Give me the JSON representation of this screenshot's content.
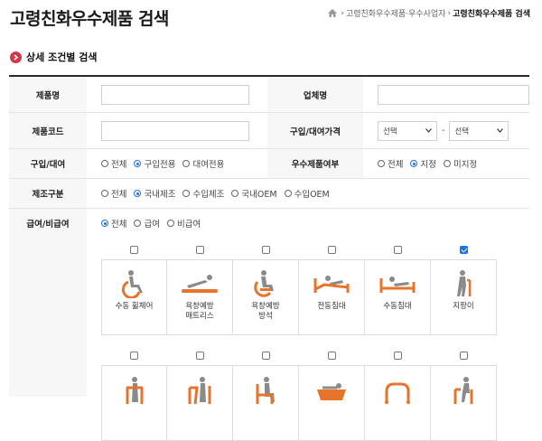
{
  "page": {
    "title": "고령친화우수제품 검색",
    "breadcrumb": {
      "item1": "고령친화우수제품·우수사업자",
      "current": "고령친화우수제품 검색"
    }
  },
  "section": {
    "title": "상세 조건별 검색"
  },
  "form": {
    "product_name": {
      "label": "제품명",
      "value": ""
    },
    "company_name": {
      "label": "업체명",
      "value": ""
    },
    "product_code": {
      "label": "제품코드",
      "value": ""
    },
    "price": {
      "label": "구입/대여가격",
      "from": "선택",
      "separator": "-",
      "to": "선택"
    },
    "purchase_rent": {
      "label": "구입/대여",
      "options": [
        {
          "label": "전체",
          "checked": false
        },
        {
          "label": "구입전용",
          "checked": true
        },
        {
          "label": "대여전용",
          "checked": false
        }
      ]
    },
    "excellent": {
      "label": "우수제품여부",
      "options": [
        {
          "label": "전체",
          "checked": false
        },
        {
          "label": "지정",
          "checked": true
        },
        {
          "label": "미지정",
          "checked": false
        }
      ]
    },
    "manufacture": {
      "label": "제조구분",
      "options": [
        {
          "label": "전체",
          "checked": false
        },
        {
          "label": "국내제조",
          "checked": true
        },
        {
          "label": "수입제조",
          "checked": false
        },
        {
          "label": "국내OEM",
          "checked": false
        },
        {
          "label": "수입OEM",
          "checked": false
        }
      ]
    },
    "benefit": {
      "label": "급여/비급여",
      "options": [
        {
          "label": "전체",
          "checked": true
        },
        {
          "label": "급여",
          "checked": false
        },
        {
          "label": "비급여",
          "checked": false
        }
      ]
    }
  },
  "categories_row1": [
    {
      "label": "수동 휠체어",
      "checked": false,
      "icon": "wheelchair-icon"
    },
    {
      "label": "욕창예방\n매트리스",
      "checked": false,
      "icon": "mattress-icon"
    },
    {
      "label": "욕창예방\n방석",
      "checked": false,
      "icon": "cushion-icon"
    },
    {
      "label": "전동침대",
      "checked": false,
      "icon": "electric-bed-icon"
    },
    {
      "label": "수동침대",
      "checked": false,
      "icon": "manual-bed-icon"
    },
    {
      "label": "지팡이",
      "checked": true,
      "icon": "cane-icon"
    }
  ],
  "categories_row2": [
    {
      "label": "",
      "checked": false,
      "icon": "walker-icon"
    },
    {
      "label": "",
      "checked": false,
      "icon": "transfer-aid-icon"
    },
    {
      "label": "",
      "checked": false,
      "icon": "bath-chair-icon"
    },
    {
      "label": "",
      "checked": false,
      "icon": "bathtub-icon"
    },
    {
      "label": "",
      "checked": false,
      "icon": "toilet-aid-icon"
    },
    {
      "label": "",
      "checked": false,
      "icon": "safety-handle-icon"
    }
  ],
  "colors": {
    "accent": "#e8742b",
    "icon_gray": "#8a8a8a",
    "bullet": "#d4364a",
    "radio": "#1a73e8"
  }
}
